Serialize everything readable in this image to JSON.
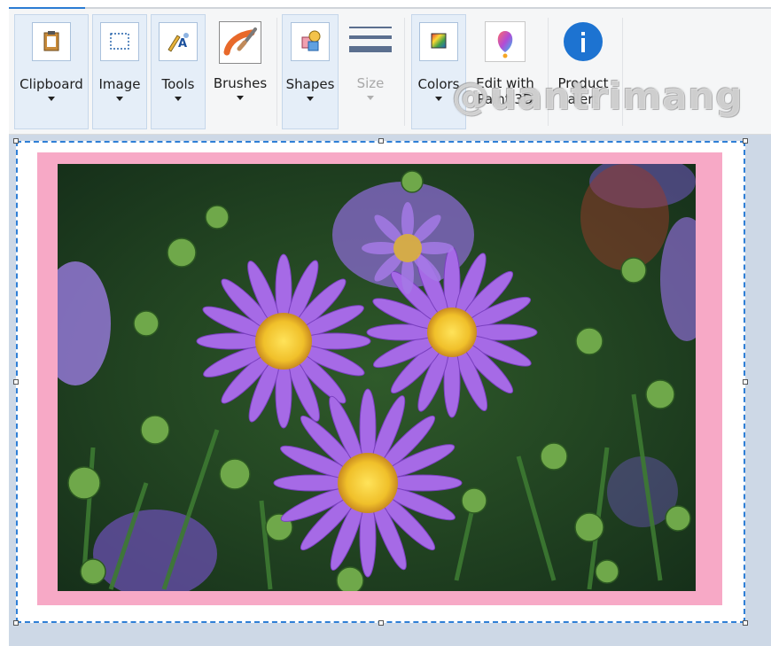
{
  "ribbon": {
    "groups": [
      {
        "label": "Clipboard",
        "icon": "clipboard-icon"
      },
      {
        "label": "Image",
        "icon": "selection-icon"
      },
      {
        "label": "Tools",
        "icon": "pencil-tools-icon"
      },
      {
        "label": "Brushes",
        "icon": "brush-icon"
      },
      {
        "label": "Shapes",
        "icon": "shapes-icon"
      },
      {
        "label": "Size",
        "icon": "line-size-icon"
      },
      {
        "label": "Colors",
        "icon": "color-palette-icon"
      },
      {
        "label_line1": "Edit with",
        "label_line2": "Paint 3D",
        "icon": "paint3d-icon"
      },
      {
        "label_line1": "Product",
        "label_line2": "alert",
        "icon": "info-icon"
      }
    ]
  },
  "watermark": "@uantrimang",
  "colors": {
    "accent": "#2b7cd3",
    "selection_border": "#2f7fd6",
    "frame_pink": "#f7a9c6",
    "workspace": "#cdd8e6"
  }
}
